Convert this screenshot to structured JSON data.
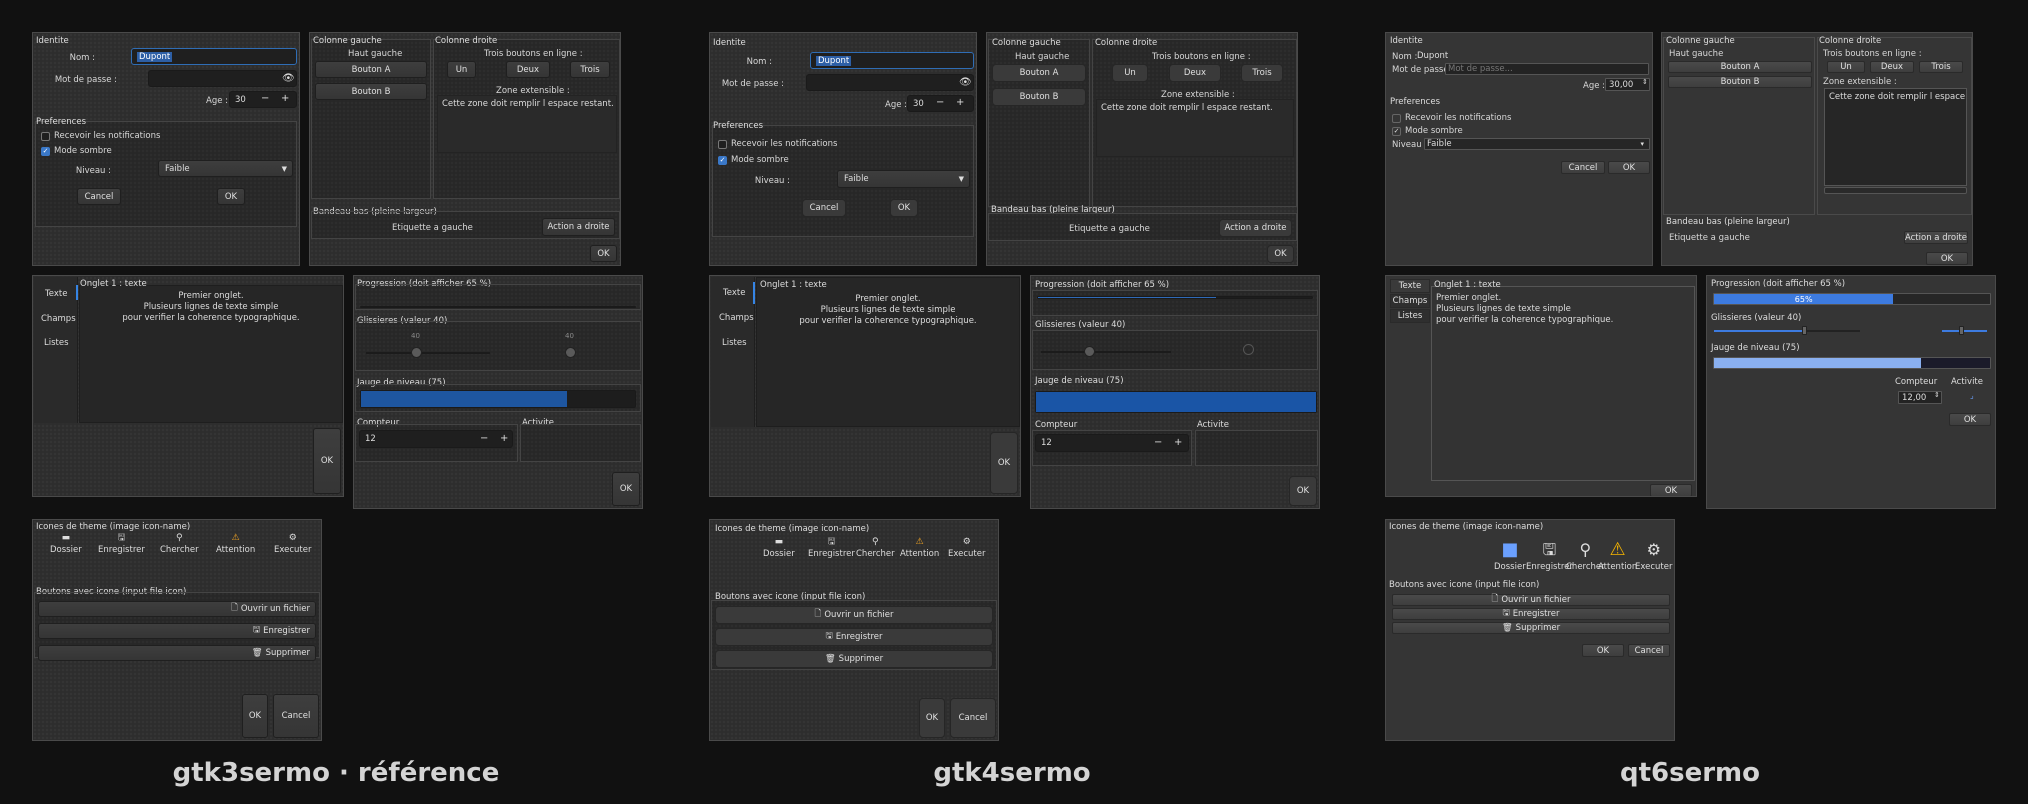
{
  "captions": {
    "gtk3": "gtk3sermo · référence",
    "gtk4": "gtk4sermo",
    "qt6": "qt6sermo"
  },
  "form": {
    "identite_title": "Identite",
    "nom_label": "Nom :",
    "nom_value": "Dupont",
    "mdp_label": "Mot de passe :",
    "mdp_placeholder": "Mot de passe...",
    "age_label": "Age :",
    "age_value": "30",
    "age_value_qt": "30,00",
    "preferences_title": "Preferences",
    "notif_label": "Recevoir les notifications",
    "dark_label": "Mode sombre",
    "niveau_label": "Niveau :",
    "niveau_value": "Faible",
    "cancel": "Cancel",
    "ok": "OK"
  },
  "columns": {
    "left_title": "Colonne gauche",
    "left_top": "Haut gauche",
    "button_a": "Bouton A",
    "button_b": "Bouton B",
    "right_title": "Colonne droite",
    "three_label": "Trois boutons en ligne :",
    "un": "Un",
    "deux": "Deux",
    "trois": "Trois",
    "zone_label": "Zone extensible :",
    "zone_text": "Cette zone doit remplir l espace restant.",
    "zone_text_qt": "Cette zone doit remplir l espace restar",
    "banner_title": "Bandeau bas (pleine largeur)",
    "banner_left": "Etiquette a gauche",
    "banner_right": "Action a droite",
    "ok": "OK"
  },
  "tabs": {
    "items": [
      "Texte",
      "Champs",
      "Listes"
    ],
    "page_title": "Onglet 1 : texte",
    "line1": "Premier onglet.",
    "line2": "Plusieurs lignes de texte simple",
    "line3": "pour verifier la coherence typographique.",
    "ok": "OK"
  },
  "widgets": {
    "progress_title": "Progression (doit afficher 65 %)",
    "progress_value": 0.65,
    "progress_text": "65%",
    "sliders_title": "Glissieres (valeur 40)",
    "slider_value": 40,
    "gauge_title": "Jauge de niveau (75)",
    "gauge_value": 0.75,
    "counter_title": "Compteur",
    "counter_value": "12",
    "counter_value_qt": "12,00",
    "activity_title": "Activite",
    "ok": "OK"
  },
  "icons": {
    "title": "Icones de theme (image icon-name)",
    "items": [
      "Dossier",
      "Enregistrer",
      "Chercher",
      "Attention",
      "Executer"
    ],
    "buttons_title": "Boutons avec icone (input file icon)",
    "open": "Ouvrir un fichier",
    "save": "Enregistrer",
    "delete": "Supprimer",
    "ok": "OK",
    "cancel": "Cancel"
  },
  "colors": {
    "accent": "#3584e4",
    "progress": "#2f6ab8",
    "warning": "#f5a623",
    "qt_progress": "#3d7be0",
    "qt_gauge": "#8ab0f0"
  }
}
